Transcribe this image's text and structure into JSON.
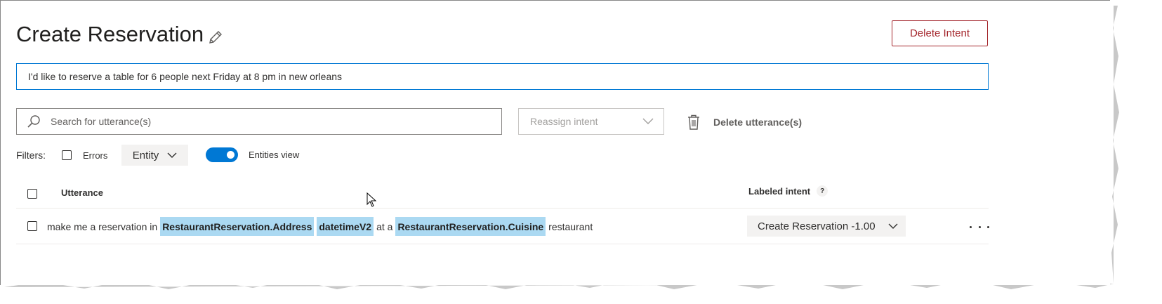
{
  "page": {
    "title": "Create Reservation",
    "delete_intent_label": "Delete Intent"
  },
  "utterance_input": {
    "value": "I'd like to reserve a table for 6 people next Friday at 8 pm in new orleans"
  },
  "toolbar": {
    "search_placeholder": "Search for utterance(s)",
    "reassign_placeholder": "Reassign intent",
    "delete_utterances_label": "Delete utterance(s)"
  },
  "filters": {
    "label": "Filters:",
    "errors_label": "Errors",
    "errors_checked": false,
    "entity_label": "Entity",
    "entities_view_label": "Entities view",
    "entities_view_on": true
  },
  "table": {
    "col_utterance": "Utterance",
    "col_labeled_intent": "Labeled intent",
    "help_glyph": "?",
    "rows": [
      {
        "tokens": [
          {
            "text": "make me a reservation in",
            "entity": false
          },
          {
            "text": "RestaurantReservation.Address",
            "entity": true
          },
          {
            "text": "datetimeV2",
            "entity": true
          },
          {
            "text": "at a",
            "entity": false
          },
          {
            "text": "RestaurantReservation.Cuisine",
            "entity": true
          },
          {
            "text": "restaurant",
            "entity": false
          }
        ],
        "labeled_intent": "Create Reservation -1.00"
      }
    ]
  },
  "colors": {
    "accent": "#0078d4",
    "danger": "#a4262c",
    "entity_highlight": "#abd9f2",
    "dropdown_bg": "#f3f2f1"
  },
  "icons": [
    "pencil-icon",
    "search-icon",
    "chevron-down-icon",
    "trash-icon",
    "help-icon",
    "more-icon",
    "mouse-pointer-icon"
  ]
}
